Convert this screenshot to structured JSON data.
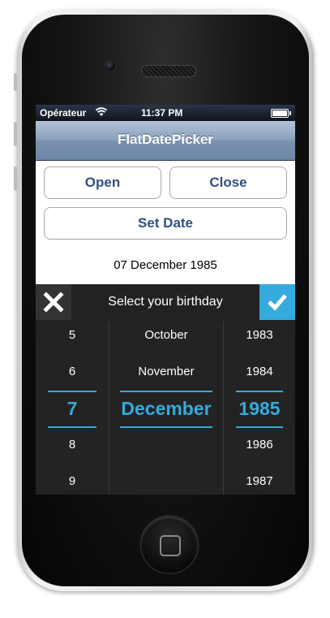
{
  "statusbar": {
    "carrier": "Opérateur",
    "time": "11:37 PM"
  },
  "navbar": {
    "title": "FlatDatePicker"
  },
  "buttons": {
    "open": "Open",
    "close": "Close",
    "set_date": "Set Date"
  },
  "selected_date_label": "07 December 1985",
  "picker": {
    "title": "Select your birthday",
    "days": [
      "5",
      "6",
      "7",
      "8",
      "9"
    ],
    "months": [
      "October",
      "November",
      "December",
      "",
      ""
    ],
    "years": [
      "1983",
      "1984",
      "1985",
      "1986",
      "1987"
    ],
    "selected_index": 2
  },
  "colors": {
    "accent": "#35aadc",
    "picker_background": "#232323",
    "navbar_button_text": "#324f85"
  },
  "icons": {
    "cancel": "close-x-icon",
    "confirm": "checkmark-icon",
    "wifi": "wifi-icon",
    "battery": "battery-icon"
  }
}
